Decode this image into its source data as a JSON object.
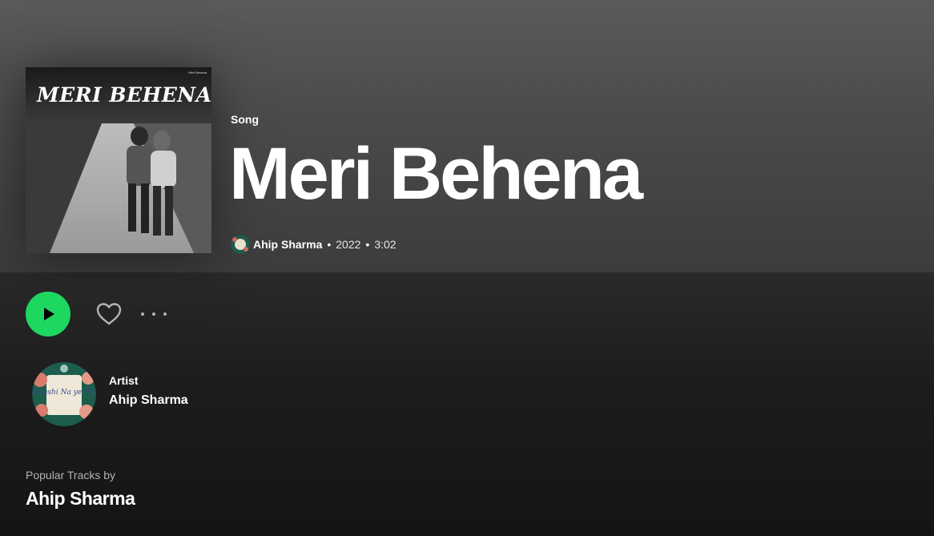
{
  "cover": {
    "title_text": "MERI BEHENA",
    "tag_text": "Meri Behena"
  },
  "header": {
    "type_label": "Song",
    "title": "Meri Behena",
    "artist": "Ahip Sharma",
    "separator": "•",
    "year": "2022",
    "duration": "3:02"
  },
  "actions": {
    "play_icon": "play-icon",
    "like_icon": "heart-icon",
    "more_icon": "more-options-icon"
  },
  "artist_card": {
    "label": "Artist",
    "name": "Ahip Sharma",
    "avatar_text": "Khushi Na ye Pal"
  },
  "popular": {
    "label": "Popular Tracks by",
    "artist": "Ahip Sharma"
  },
  "colors": {
    "accent": "#1ed760",
    "background": "#121212",
    "muted_text": "#b3b3b3"
  }
}
